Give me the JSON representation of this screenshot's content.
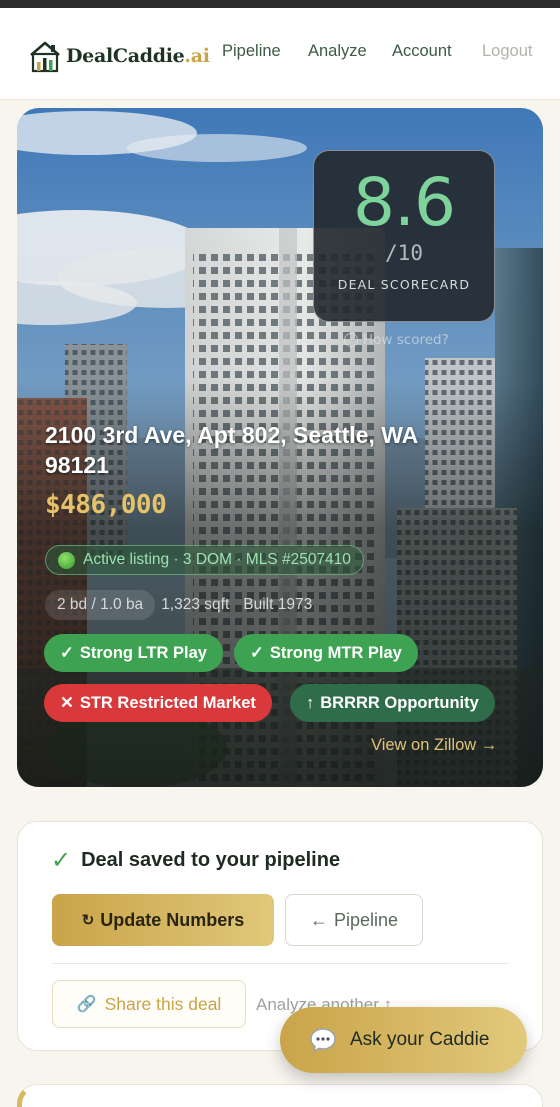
{
  "nav": {
    "brand_main": "DealCaddie",
    "brand_suffix": ".ai",
    "links": [
      "Pipeline",
      "Analyze",
      "Account",
      "Logout"
    ]
  },
  "hero": {
    "score_value": "8.6",
    "score_denominator": "/10",
    "score_label": "DEAL SCORECARD",
    "how_scored": "How scored?",
    "address": "2100 3rd Ave, Apt 802, Seattle, WA 98121",
    "price": "$486,000",
    "status": "Active listing · 3 DOM · MLS #2507410",
    "specs": {
      "beds_baths": "2 bd / 1.0 ba",
      "sqft": "1,323 sqft",
      "built": "Built 1973"
    },
    "tags": {
      "ltr": "Strong LTR Play",
      "mtr": "Strong MTR Play",
      "str": "STR Restricted Market",
      "brrrr": "BRRRR Opportunity"
    },
    "zillow_link": "View on Zillow →"
  },
  "saved_card": {
    "title": "Deal saved to your pipeline",
    "update_button": "Update Numbers",
    "pipeline_button": "Pipeline",
    "share_button": "Share this deal",
    "analyze_another": "Analyze another ↑"
  },
  "fab": {
    "label": "Ask your Caddie"
  },
  "colors": {
    "accent_gold": "#c9a449",
    "score_green": "#7ed39a",
    "tag_green": "#3da352",
    "tag_red": "#d9393a",
    "tag_dark_green": "#2f6d4a",
    "brand_dark": "#1e3323"
  },
  "icons": {
    "logo": "house-chart-icon",
    "status": "green-circle-icon",
    "check": "check-icon",
    "cross": "x-icon",
    "up_arrow": "up-arrow-icon",
    "refresh": "refresh-icon",
    "back": "left-arrow-icon",
    "share": "link-icon",
    "chat": "chat-bubble-icon"
  }
}
